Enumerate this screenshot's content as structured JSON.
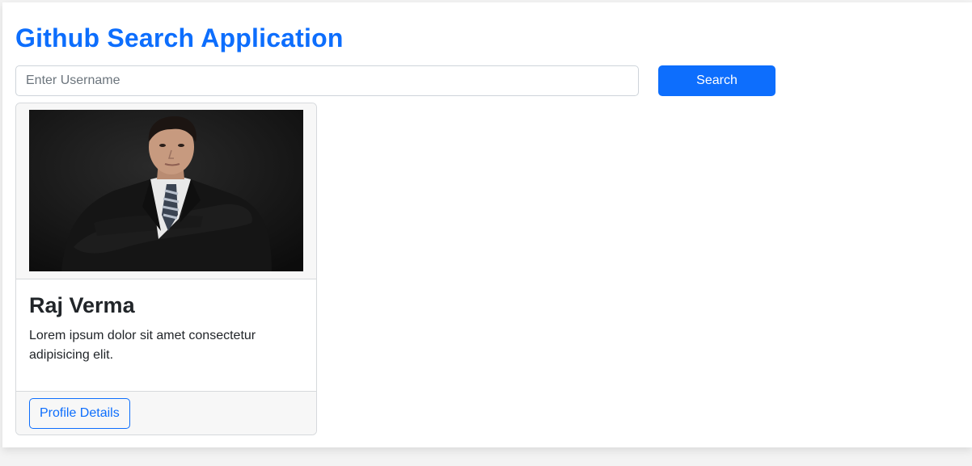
{
  "app": {
    "title": "Github Search Application"
  },
  "search": {
    "placeholder": "Enter Username",
    "value": "",
    "button_label": "Search"
  },
  "card": {
    "name": "Raj Verma",
    "description": "Lorem ipsum dolor sit amet consectetur adipisicing elit.",
    "button_label": "Profile Details",
    "avatar_icon": "profile-photo"
  },
  "colors": {
    "accent": "#0d6efd",
    "text": "#212529",
    "border": "#d6d9dc",
    "card_header_bg": "#f7f7f7"
  }
}
